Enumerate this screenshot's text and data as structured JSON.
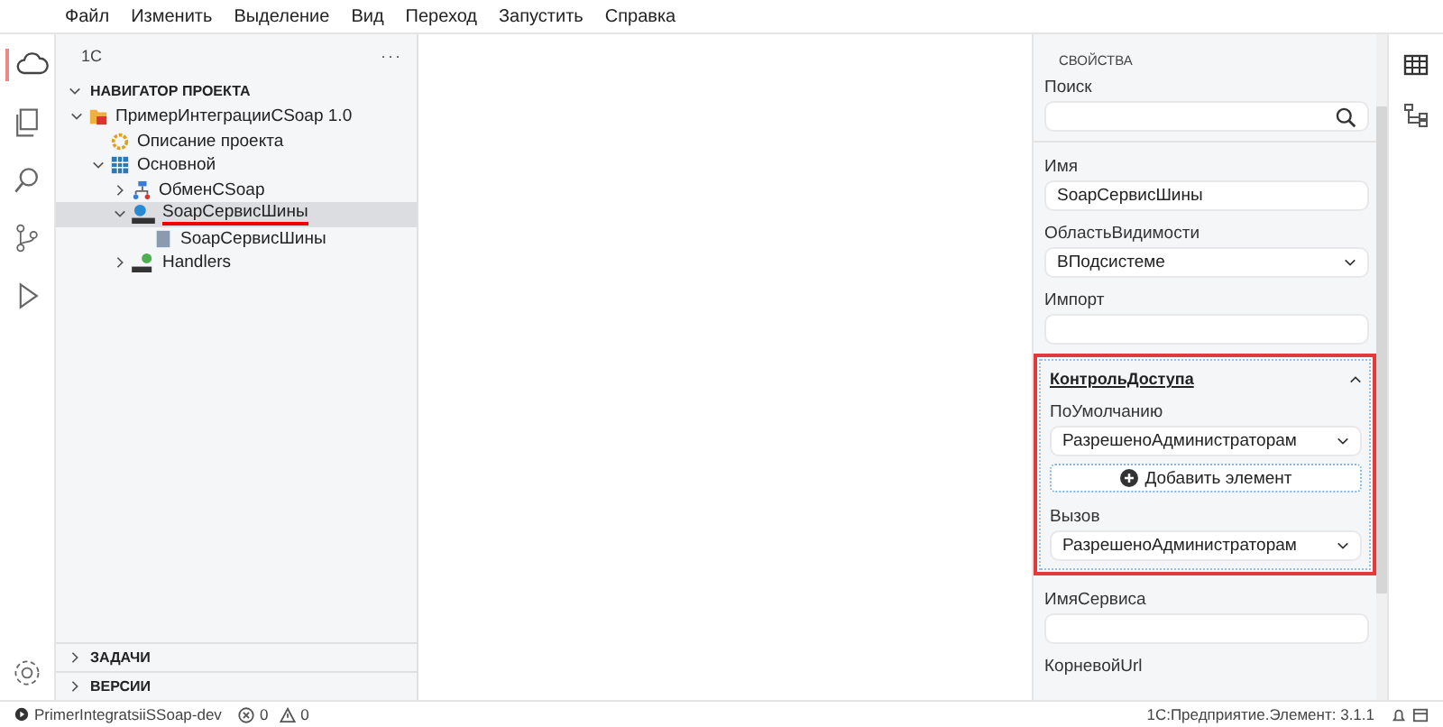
{
  "menu": [
    "Файл",
    "Изменить",
    "Выделение",
    "Вид",
    "Переход",
    "Запустить",
    "Справка"
  ],
  "sidebar": {
    "header": "1С",
    "more": "···",
    "section": {
      "label": "НАВИГАТОР ПРОЕКТА",
      "expanded": true
    },
    "tree": [
      {
        "label": "ПримерИнтеграцииCSoap 1.0",
        "kind": "project",
        "expanded": true,
        "selected": false,
        "underlined": false,
        "children": [
          {
            "label": "Описание проекта",
            "kind": "settings",
            "selected": false,
            "underlined": false
          },
          {
            "label": "Основной",
            "kind": "subsystem",
            "expanded": true,
            "selected": false,
            "underlined": false,
            "children": [
              {
                "label": "ОбменCSoap",
                "kind": "exchange",
                "expanded": false,
                "selected": false,
                "underlined": false
              },
              {
                "label": "SoapСервисШины",
                "kind": "soap-service",
                "expanded": true,
                "selected": true,
                "underlined": true,
                "children": [
                  {
                    "label": "SoapСервисШины",
                    "kind": "document",
                    "selected": false,
                    "underlined": false
                  }
                ]
              },
              {
                "label": "Handlers",
                "kind": "soap-handlers",
                "expanded": false,
                "selected": false,
                "underlined": false
              }
            ]
          }
        ]
      }
    ],
    "panels": [
      {
        "label": "ЗАДАЧИ",
        "expanded": false
      },
      {
        "label": "ВЕРСИИ",
        "expanded": false
      }
    ]
  },
  "properties": {
    "title": "СВОЙСТВА",
    "search": {
      "label": "Поиск"
    },
    "fields": [
      {
        "kind": "text",
        "label": "Имя",
        "value": "SoapСервисШины"
      },
      {
        "kind": "select",
        "label": "ОбластьВидимости",
        "value": "ВПодсистеме"
      },
      {
        "kind": "text",
        "label": "Импорт"
      },
      {
        "kind": "group",
        "label": "КонтрольДоступа",
        "expanded": true,
        "highlighted": true,
        "add_button": "Добавить элемент",
        "fields": [
          {
            "kind": "select",
            "label": "ПоУмолчанию",
            "value": "РазрешеноАдминистраторам"
          },
          {
            "kind": "select",
            "label": "Вызов",
            "value": "РазрешеноАдминистраторам"
          }
        ]
      },
      {
        "kind": "text",
        "label": "ИмяСервиса"
      },
      {
        "kind": "label",
        "label": "КорневойUrl"
      }
    ]
  },
  "status_bar": {
    "project": "PrimerIntegratsiiSSoap-dev",
    "errors": "0",
    "warnings": "0",
    "version": "1С:Предприятие.Элемент: 3.1.1"
  }
}
